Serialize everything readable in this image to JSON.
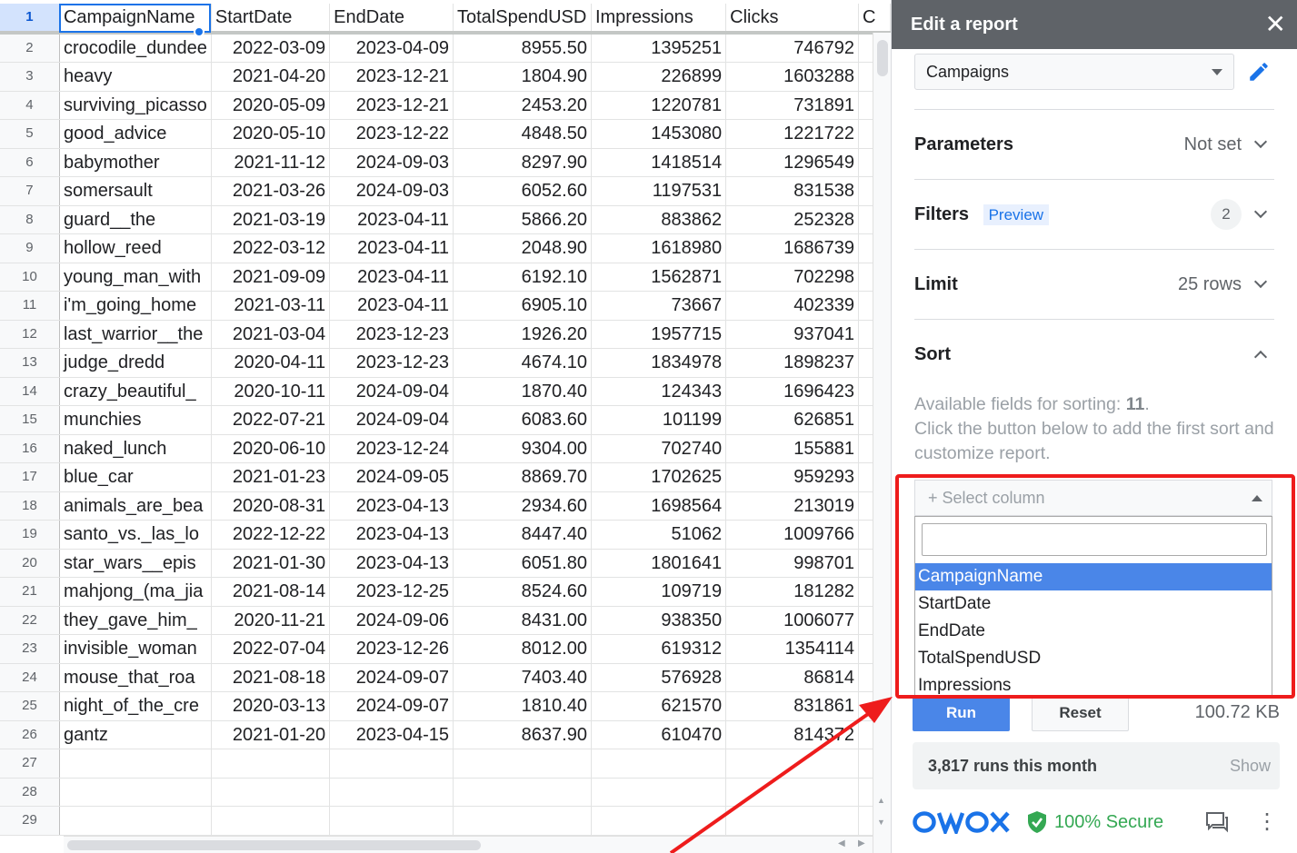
{
  "sheet": {
    "active_row": "1",
    "rows": [
      [
        "1",
        "CampaignName",
        "StartDate",
        "EndDate",
        "TotalSpendUSD",
        "Impressions",
        "Clicks",
        "C"
      ],
      [
        "2",
        "crocodile_dundee",
        "2022-03-09",
        "2023-04-09",
        "8955.50",
        "1395251",
        "746792",
        ""
      ],
      [
        "3",
        "heavy",
        "2021-04-20",
        "2023-12-21",
        "1804.90",
        "226899",
        "1603288",
        ""
      ],
      [
        "4",
        "surviving_picasso",
        "2020-05-09",
        "2023-12-21",
        "2453.20",
        "1220781",
        "731891",
        ""
      ],
      [
        "5",
        "good_advice",
        "2020-05-10",
        "2023-12-22",
        "4848.50",
        "1453080",
        "1221722",
        ""
      ],
      [
        "6",
        "babymother",
        "2021-11-12",
        "2024-09-03",
        "8297.90",
        "1418514",
        "1296549",
        ""
      ],
      [
        "7",
        "somersault",
        "2021-03-26",
        "2024-09-03",
        "6052.60",
        "1197531",
        "831538",
        ""
      ],
      [
        "8",
        "guard__the",
        "2021-03-19",
        "2023-04-11",
        "5866.20",
        "883862",
        "252328",
        ""
      ],
      [
        "9",
        "hollow_reed",
        "2022-03-12",
        "2023-04-11",
        "2048.90",
        "1618980",
        "1686739",
        ""
      ],
      [
        "10",
        "young_man_with",
        "2021-09-09",
        "2023-04-11",
        "6192.10",
        "1562871",
        "702298",
        ""
      ],
      [
        "11",
        "i'm_going_home",
        "2021-03-11",
        "2023-04-11",
        "6905.10",
        "73667",
        "402339",
        ""
      ],
      [
        "12",
        "last_warrior__the",
        "2021-03-04",
        "2023-12-23",
        "1926.20",
        "1957715",
        "937041",
        ""
      ],
      [
        "13",
        "judge_dredd",
        "2020-04-11",
        "2023-12-23",
        "4674.10",
        "1834978",
        "1898237",
        ""
      ],
      [
        "14",
        "crazy_beautiful_",
        "2020-10-11",
        "2024-09-04",
        "1870.40",
        "124343",
        "1696423",
        ""
      ],
      [
        "15",
        "munchies",
        "2022-07-21",
        "2024-09-04",
        "6083.60",
        "101199",
        "626851",
        ""
      ],
      [
        "16",
        "naked_lunch",
        "2020-06-10",
        "2023-12-24",
        "9304.00",
        "702740",
        "155881",
        ""
      ],
      [
        "17",
        "blue_car",
        "2021-01-23",
        "2024-09-05",
        "8869.70",
        "1702625",
        "959293",
        ""
      ],
      [
        "18",
        "animals_are_bea",
        "2020-08-31",
        "2023-04-13",
        "2934.60",
        "1698564",
        "213019",
        ""
      ],
      [
        "19",
        "santo_vs._las_lo",
        "2022-12-22",
        "2023-04-13",
        "8447.40",
        "51062",
        "1009766",
        ""
      ],
      [
        "20",
        "star_wars__epis",
        "2021-01-30",
        "2023-04-13",
        "6051.80",
        "1801641",
        "998701",
        ""
      ],
      [
        "21",
        "mahjong_(ma_jia",
        "2021-08-14",
        "2023-12-25",
        "8524.60",
        "109719",
        "181282",
        ""
      ],
      [
        "22",
        "they_gave_him_",
        "2020-11-21",
        "2024-09-06",
        "8431.00",
        "938350",
        "1006077",
        ""
      ],
      [
        "23",
        "invisible_woman",
        "2022-07-04",
        "2023-12-26",
        "8012.00",
        "619312",
        "1354114",
        ""
      ],
      [
        "24",
        "mouse_that_roa",
        "2021-08-18",
        "2024-09-07",
        "7403.40",
        "576928",
        "86814",
        ""
      ],
      [
        "25",
        "night_of_the_cre",
        "2020-03-13",
        "2024-09-07",
        "1810.40",
        "621570",
        "831861",
        ""
      ],
      [
        "26",
        "gantz",
        "2021-01-20",
        "2023-04-15",
        "8637.90",
        "610470",
        "814372",
        ""
      ],
      [
        "27",
        "",
        "",
        "",
        "",
        "",
        "",
        ""
      ],
      [
        "28",
        "",
        "",
        "",
        "",
        "",
        "",
        ""
      ],
      [
        "29",
        "",
        "",
        "",
        "",
        "",
        "",
        ""
      ]
    ]
  },
  "sidebar": {
    "title": "Edit a report",
    "report_select": "Campaigns",
    "sections": {
      "parameters": {
        "label": "Parameters",
        "value": "Not set"
      },
      "filters": {
        "label": "Filters",
        "badge": "Preview",
        "count": "2"
      },
      "limit": {
        "label": "Limit",
        "value": "25 rows"
      },
      "sort": {
        "label": "Sort"
      }
    },
    "sort_help": {
      "line1_prefix": "Available fields for sorting: ",
      "line1_count": "11",
      "line1_suffix": ".",
      "line2": "Click the button below to add the first sort and customize report."
    },
    "select_column": {
      "placeholder": "+ Select column"
    },
    "dropdown": {
      "search_value": "",
      "options": [
        "CampaignName",
        "StartDate",
        "EndDate",
        "TotalSpendUSD",
        "Impressions"
      ],
      "highlighted_index": 0
    },
    "buttons": {
      "run": "Run",
      "reset": "Reset"
    },
    "size": "100.72 KB",
    "runs": {
      "text": "3,817 runs this month",
      "show": "Show"
    },
    "footer": {
      "brand": "OWOX",
      "secure": "100% Secure"
    }
  },
  "colors": {
    "accent": "#4a86e8",
    "annotation": "#ee1c1c",
    "secure_green": "#34a853",
    "header_bar": "#5f6368"
  },
  "icons": [
    "close-icon",
    "pencil-icon",
    "chevron-down-icon",
    "chevron-up-icon",
    "caret-up-icon",
    "shield-check-icon",
    "chat-icon",
    "more-vert-icon"
  ]
}
